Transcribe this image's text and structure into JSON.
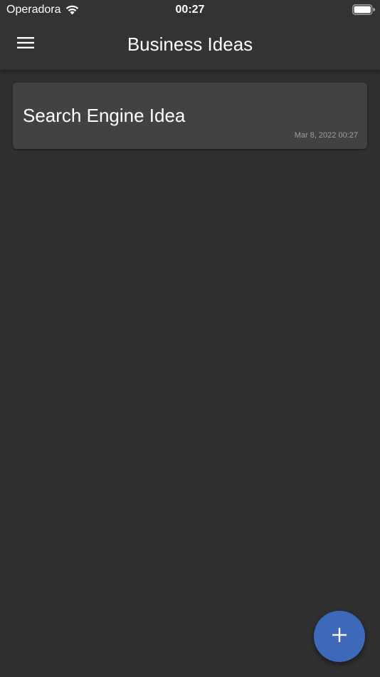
{
  "status_bar": {
    "carrier": "Operadora",
    "time": "00:27",
    "icons": [
      "wifi-icon",
      "battery-icon"
    ]
  },
  "app_bar": {
    "title": "Business Ideas",
    "menu_icon": "menu-icon"
  },
  "ideas": [
    {
      "title": "Search Engine Idea",
      "date": "Mar 8, 2022 00:27"
    }
  ],
  "fab": {
    "icon": "plus-icon"
  },
  "colors": {
    "background": "#303030",
    "app_bar": "#333333",
    "card": "#424242",
    "accent": "#3e68b8",
    "text_primary": "#ffffff",
    "text_secondary": "#9e9e9e"
  }
}
